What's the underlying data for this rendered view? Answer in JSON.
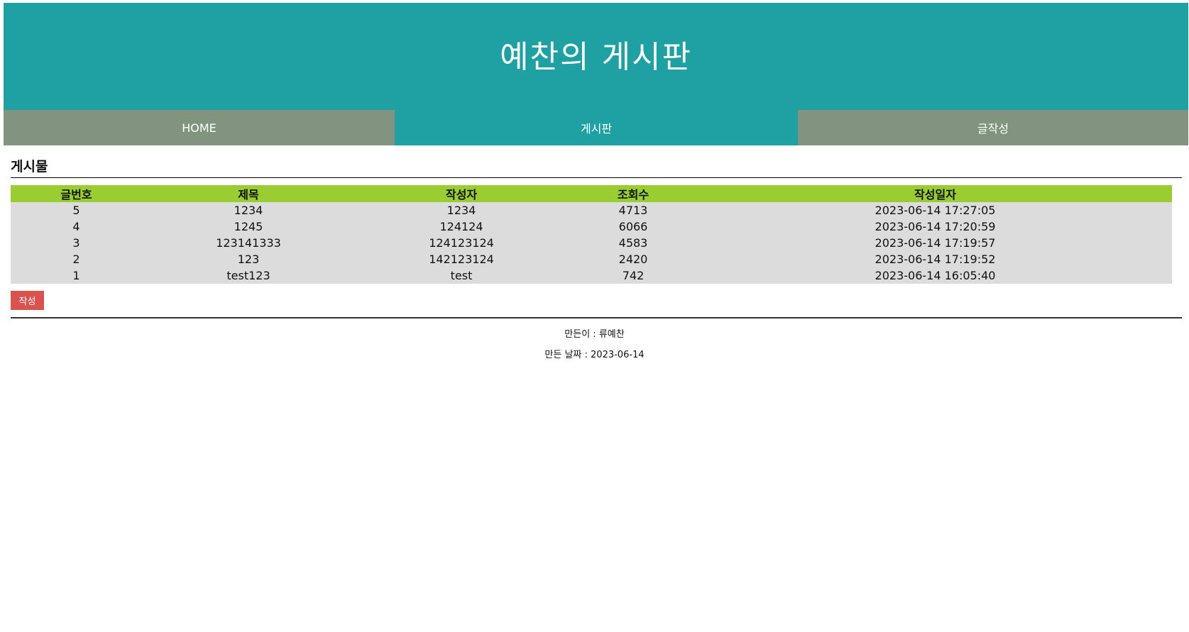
{
  "header": {
    "title": "예찬의 게시판"
  },
  "nav": {
    "items": [
      {
        "label": "HOME"
      },
      {
        "label": "게시판"
      },
      {
        "label": "글작성"
      }
    ]
  },
  "board": {
    "section_title": "게시물",
    "columns": [
      "글번호",
      "제목",
      "작성자",
      "조회수",
      "작성일자"
    ],
    "rows": [
      [
        "5",
        "1234",
        "1234",
        "4713",
        "2023-06-14 17:27:05"
      ],
      [
        "4",
        "1245",
        "124124",
        "6066",
        "2023-06-14 17:20:59"
      ],
      [
        "3",
        "123141333",
        "124123124",
        "4583",
        "2023-06-14 17:19:57"
      ],
      [
        "2",
        "123",
        "142123124",
        "2420",
        "2023-06-14 17:19:52"
      ],
      [
        "1",
        "test123",
        "test",
        "742",
        "2023-06-14 16:05:40"
      ]
    ],
    "write_button_label": "작성"
  },
  "footer": {
    "maker": "만든이 : 류예찬",
    "date": "만든 날짜 : 2023-06-14"
  },
  "colors": {
    "header_bg": "#1fa0a2",
    "nav_inactive_bg": "#82947f",
    "table_header_bg": "#9acd32",
    "table_row_bg": "#dcdcdc",
    "button_bg": "#d9534f"
  }
}
